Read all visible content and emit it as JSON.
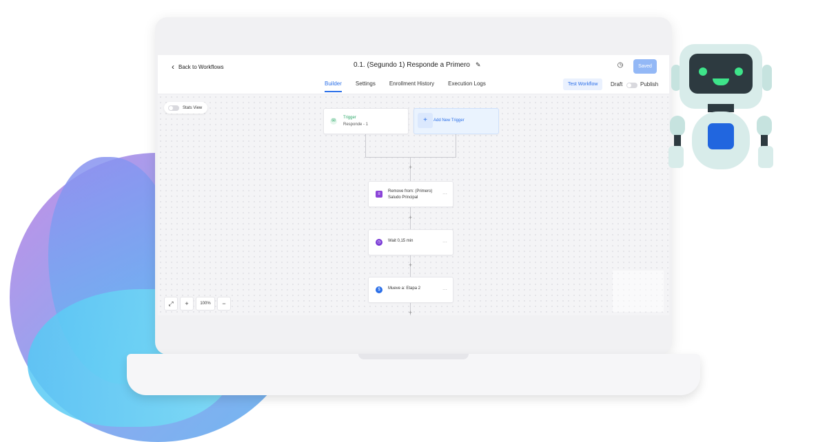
{
  "header": {
    "back_label": "Back to Workflows",
    "workflow_title": "0.1. (Segundo 1) Responde a Primero",
    "saved_label": "Saved"
  },
  "tabs": [
    {
      "label": "Builder",
      "active": true
    },
    {
      "label": "Settings",
      "active": false
    },
    {
      "label": "Enrollment History",
      "active": false
    },
    {
      "label": "Execution Logs",
      "active": false
    }
  ],
  "actions": {
    "test_workflow_label": "Test Workflow",
    "draft_label": "Draft",
    "publish_label": "Publish"
  },
  "canvas": {
    "stats_view_label": "Stats View",
    "trigger": {
      "title": "Trigger",
      "subtitle": "Responde - 1"
    },
    "add_trigger_label": "Add New Trigger",
    "steps": [
      {
        "line1": "Remove from: (Primero)",
        "line2": "Saludo Principal",
        "icon": "list-remove-icon"
      },
      {
        "line1": "Wait 0,15 min",
        "line2": "",
        "icon": "clock-icon"
      },
      {
        "line1": "Mueve a: Etapa 2",
        "line2": "",
        "icon": "dollar-icon"
      }
    ],
    "zoom_level": "100%"
  },
  "colors": {
    "accent": "#2b6fe8",
    "saved_button": "#93b8f6",
    "trigger_green": "#2ea86a",
    "purple": "#8b44d8"
  }
}
